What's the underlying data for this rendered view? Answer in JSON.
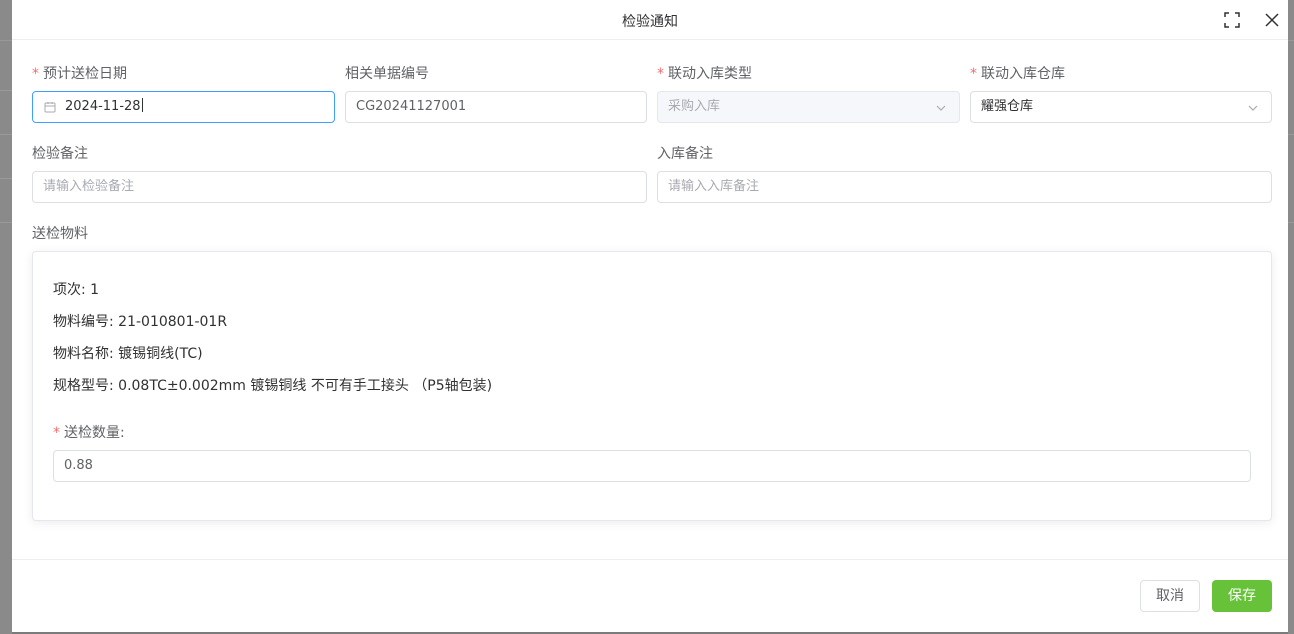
{
  "dialog": {
    "title": "检验通知",
    "fullscreen_icon": "fullscreen-icon",
    "close_icon": "close-icon"
  },
  "form": {
    "expected_date": {
      "label": "预计送检日期",
      "required": true,
      "value": "2024-11-28",
      "icon": "calendar-icon"
    },
    "related_doc_no": {
      "label": "相关单据编号",
      "required": false,
      "value": "CG20241127001"
    },
    "inbound_type": {
      "label": "联动入库类型",
      "required": true,
      "value": "采购入库",
      "disabled": true,
      "icon": "chevron-down-icon"
    },
    "inbound_warehouse": {
      "label": "联动入库仓库",
      "required": true,
      "value": "耀强仓库",
      "icon": "chevron-down-icon"
    },
    "inspection_remark": {
      "label": "检验备注",
      "placeholder": "请输入检验备注",
      "value": ""
    },
    "inbound_remark": {
      "label": "入库备注",
      "placeholder": "请输入入库备注",
      "value": ""
    }
  },
  "materials": {
    "section_label": "送检物料",
    "item": {
      "index_line": "项次: 1",
      "code_line": "物料编号: 21-010801-01R",
      "name_line": "物料名称: 镀锡铜线(TC)",
      "spec_line": "规格型号: 0.08TC±0.002mm 镀锡铜线 不可有手工接头 （P5轴包装)",
      "qty_label": "送检数量:",
      "qty_value": "0.88"
    }
  },
  "footer": {
    "cancel_label": "取消",
    "save_label": "保存"
  },
  "colors": {
    "primary_focus": "#409eff",
    "save_button": "#67c23a",
    "required_mark": "#f56c6c"
  }
}
